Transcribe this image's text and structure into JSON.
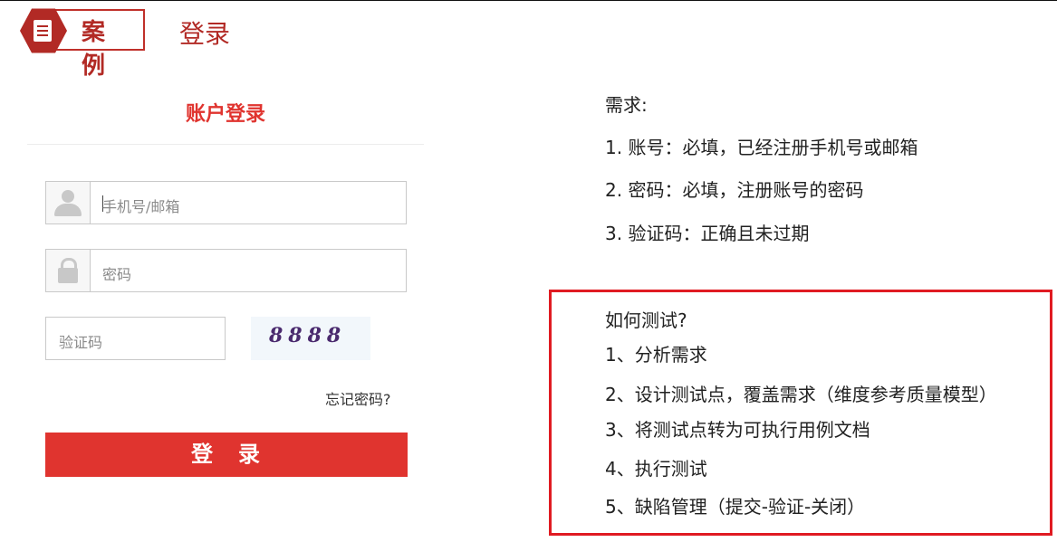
{
  "header": {
    "badge_text": "案例",
    "title": "登录"
  },
  "login": {
    "title": "账户登录",
    "account_placeholder": "手机号/邮箱",
    "password_placeholder": "密码",
    "captcha_placeholder": "验证码",
    "captcha_code": "8888",
    "forgot_link": "忘记密码?",
    "submit_label": "登　录"
  },
  "requirements": {
    "title": "需求:",
    "items": [
      "1.   账号：必填，已经注册手机号或邮箱",
      "2.   密码：必填，注册账号的密码",
      "3.   验证码：正确且未过期"
    ]
  },
  "how_to_test": {
    "title": "如何测试?",
    "items": [
      "1、分析需求",
      "2、设计测试点，覆盖需求（维度参考质量模型）",
      "3、将测试点转为可执行用例文档",
      "4、执行测试",
      "5、缺陷管理（提交-验证-关闭）"
    ]
  },
  "icons": {
    "badge": "document-icon",
    "account": "user-icon",
    "password": "lock-icon"
  },
  "colors": {
    "brand_red": "#b22a25",
    "button_red": "#e0342f",
    "highlight_border": "#e01b22"
  }
}
